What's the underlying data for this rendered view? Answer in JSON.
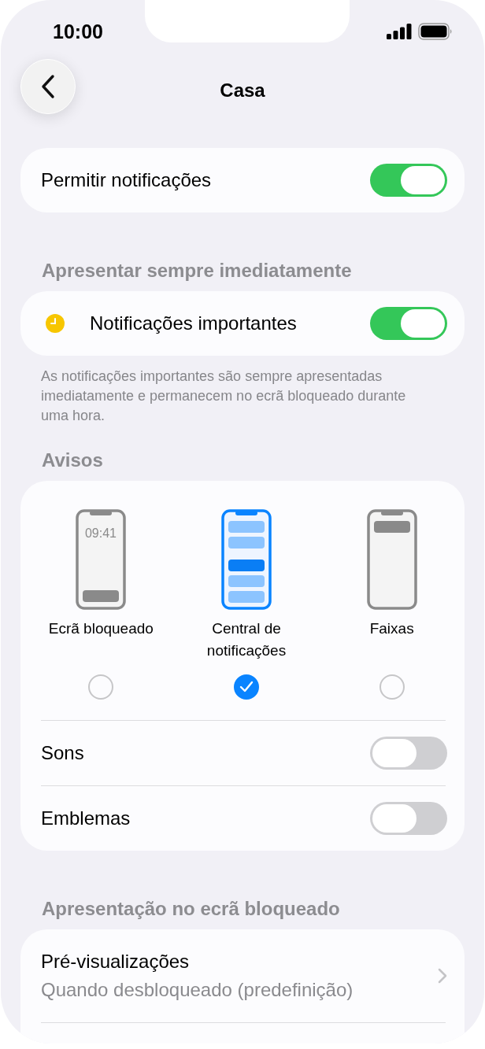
{
  "status_bar": {
    "time": "10:00"
  },
  "nav": {
    "title": "Casa"
  },
  "allow": {
    "label": "Permitir notificações",
    "on": true
  },
  "immediate": {
    "header": "Apresentar sempre imediatamente",
    "label": "Notificações importantes",
    "on": true,
    "footnote": "As notificações importantes são sempre apresentadas imediatamente e permanecem no ecrã bloqueado durante uma hora."
  },
  "alerts": {
    "header": "Avisos",
    "options": [
      {
        "kind": "lock",
        "label": "Ecrã bloqueado",
        "clock": "09:41",
        "selected": false
      },
      {
        "kind": "center",
        "label": "Central de notificações",
        "selected": true
      },
      {
        "kind": "banner",
        "label": "Faixas",
        "selected": false
      }
    ],
    "toggles": [
      {
        "label": "Sons",
        "on": false
      },
      {
        "label": "Emblemas",
        "on": false
      }
    ]
  },
  "lock_screen": {
    "header": "Apresentação no ecrã bloqueado",
    "rows": [
      {
        "label": "Pré-visualizações",
        "value": "Quando desbloqueado (predefinição)"
      }
    ]
  }
}
